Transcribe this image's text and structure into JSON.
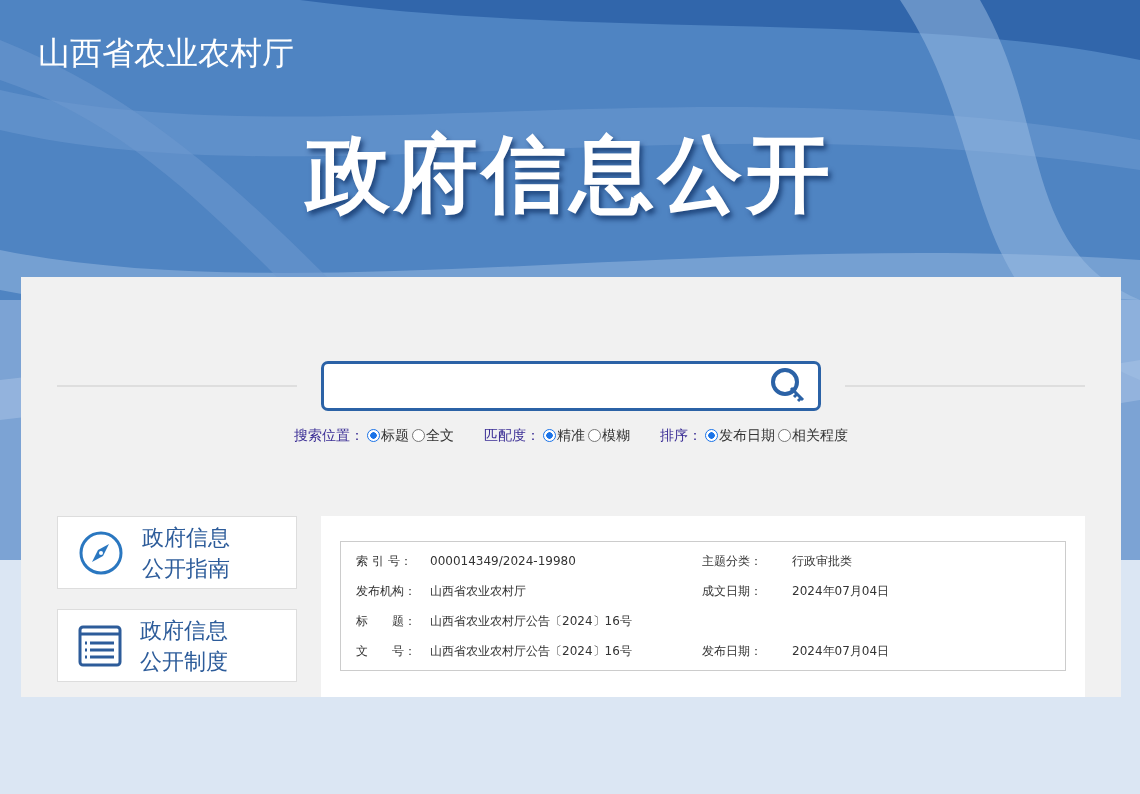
{
  "site_name": "山西省农业农村厅",
  "banner_title": "政府信息公开",
  "filters": [
    {
      "label": "搜索位置：",
      "options": [
        {
          "label": "标题",
          "selected": true
        },
        {
          "label": "全文",
          "selected": false
        }
      ]
    },
    {
      "label": "匹配度：",
      "options": [
        {
          "label": "精准",
          "selected": true
        },
        {
          "label": "模糊",
          "selected": false
        }
      ]
    },
    {
      "label": "排序：",
      "options": [
        {
          "label": "发布日期",
          "selected": true
        },
        {
          "label": "相关程度",
          "selected": false
        }
      ]
    }
  ],
  "side_links": [
    {
      "kind": "compass",
      "lines": [
        "政府信息",
        "公开指南"
      ]
    },
    {
      "kind": "book",
      "lines": [
        "政府信息",
        "公开制度"
      ]
    }
  ],
  "meta_rows": [
    {
      "label": "索 引 号：",
      "value": "000014349/2024-19980",
      "label_2": "主题分类：",
      "value_2": "行政审批类"
    },
    {
      "label": "发布机构：",
      "value": "山西省农业农村厅",
      "label_2": "成文日期：",
      "value_2": "2024年07月04日"
    },
    {
      "label": "标　　题：",
      "value": "山西省农业农村厅公告〔2024〕16号"
    },
    {
      "label": "文　　号：",
      "value": "山西省农业农村厅公告〔2024〕16号",
      "label_2": "发布日期：",
      "value_2": "2024年07月04日"
    }
  ]
}
